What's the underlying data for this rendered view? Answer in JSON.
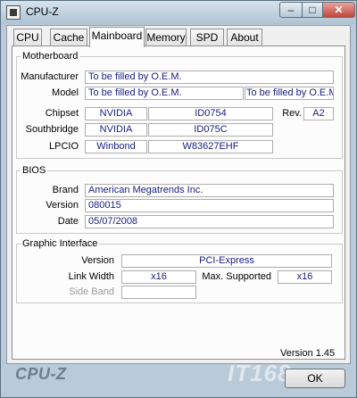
{
  "window": {
    "title": "CPU-Z",
    "controls": {
      "minimize": "–",
      "maximize": "□",
      "close": "✕"
    }
  },
  "tabs": [
    "CPU",
    "Cache",
    "Mainboard",
    "Memory",
    "SPD",
    "About"
  ],
  "active_tab": "Mainboard",
  "motherboard": {
    "legend": "Motherboard",
    "manufacturer_label": "Manufacturer",
    "manufacturer": "To be filled by O.E.M.",
    "model_label": "Model",
    "model": "To be filled by O.E.M.",
    "model_revision": "To be filled by O.E.M",
    "chipset_label": "Chipset",
    "chipset_vendor": "NVIDIA",
    "chipset_model": "ID0754",
    "rev_label": "Rev.",
    "rev": "A2",
    "southbridge_label": "Southbridge",
    "southbridge_vendor": "NVIDIA",
    "southbridge_model": "ID075C",
    "lpcio_label": "LPCIO",
    "lpcio_vendor": "Winbond",
    "lpcio_model": "W83627EHF"
  },
  "bios": {
    "legend": "BIOS",
    "brand_label": "Brand",
    "brand": "American Megatrends Inc.",
    "version_label": "Version",
    "version": "080015",
    "date_label": "Date",
    "date": "05/07/2008"
  },
  "graphic": {
    "legend": "Graphic Interface",
    "version_label": "Version",
    "version": "PCI-Express",
    "link_width_label": "Link Width",
    "link_width": "x16",
    "max_supported_label": "Max. Supported",
    "max_supported": "x16",
    "side_band_label": "Side Band",
    "side_band": ""
  },
  "footer": {
    "logo": "CPU-Z",
    "version_text": "Version 1.45",
    "ok_label": "OK",
    "watermark": "IT168"
  }
}
